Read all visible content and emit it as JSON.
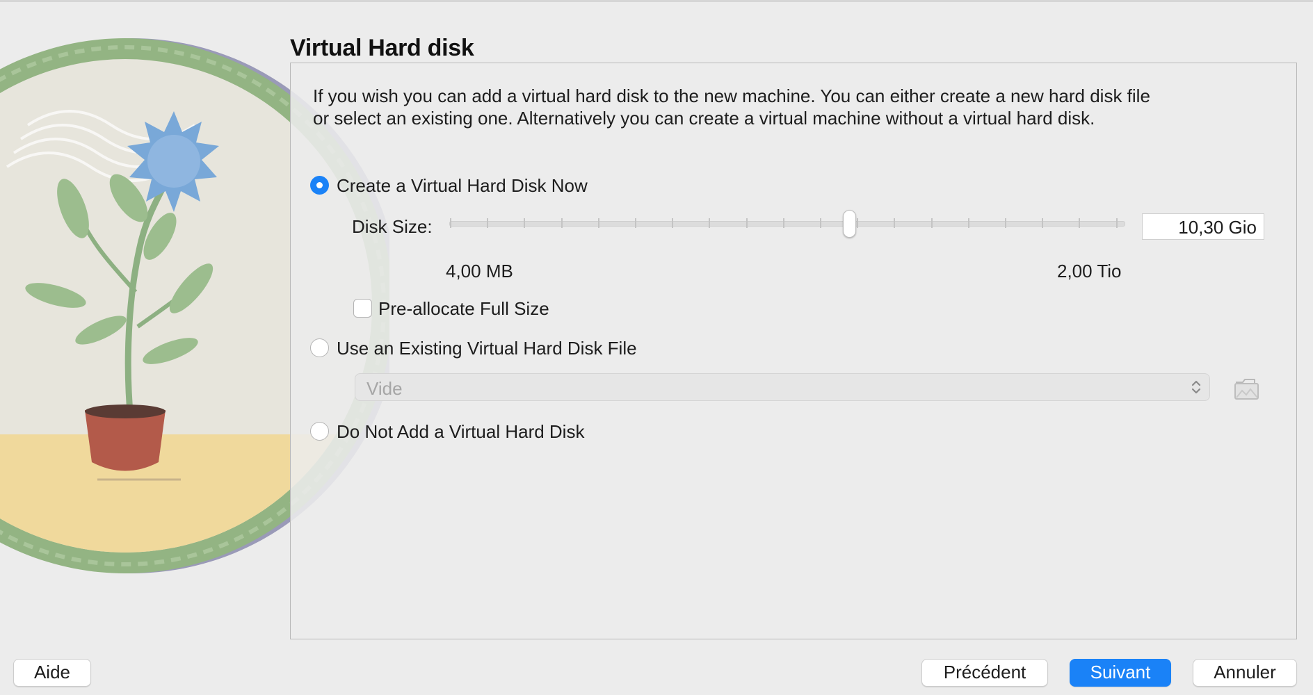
{
  "page": {
    "heading": "Virtual Hard disk",
    "description": "If you wish you can add a virtual hard disk to the new machine. You can either create a new hard disk file or select an existing one. Alternatively you can create a virtual machine without a virtual hard disk."
  },
  "options": {
    "create_now": {
      "label": "Create a Virtual Hard Disk Now",
      "selected": true
    },
    "use_existing": {
      "label": "Use an Existing Virtual Hard Disk File",
      "selected": false
    },
    "do_not_add": {
      "label": "Do Not Add a Virtual Hard Disk",
      "selected": false
    }
  },
  "disk_size": {
    "label": "Disk Size:",
    "value": "10,30 Gio",
    "min_label": "4,00 MB",
    "max_label": "2,00 Tio"
  },
  "preallocate": {
    "label": "Pre-allocate Full Size",
    "checked": false
  },
  "existing_file_select": {
    "value": "Vide",
    "folder_icon": "folder-open-icon"
  },
  "buttons": {
    "help": "Aide",
    "back": "Précédent",
    "next": "Suivant",
    "cancel": "Annuler"
  },
  "colors": {
    "accent": "#1a82f7",
    "background": "#ececec"
  }
}
